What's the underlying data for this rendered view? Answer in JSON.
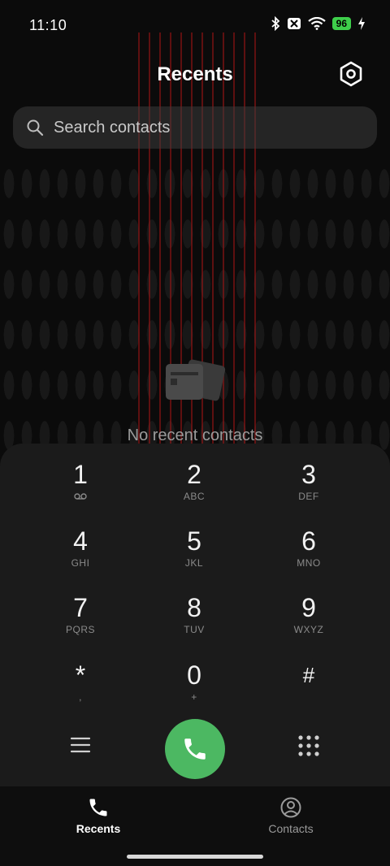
{
  "status_bar": {
    "time": "11:10",
    "battery_level": "96",
    "icons": [
      "bluetooth-icon",
      "sim-off-icon",
      "wifi-icon",
      "battery-icon",
      "charging-icon"
    ]
  },
  "header": {
    "title": "Recents",
    "settings_icon": "settings-hexagon-icon"
  },
  "search": {
    "placeholder": "Search contacts",
    "icon": "search-icon"
  },
  "empty_state": {
    "icon": "recent-contacts-empty-icon",
    "text": "No recent contacts"
  },
  "dialpad": {
    "keys": [
      {
        "digit": "1",
        "letters": "",
        "voicemail": true
      },
      {
        "digit": "2",
        "letters": "ABC"
      },
      {
        "digit": "3",
        "letters": "DEF"
      },
      {
        "digit": "4",
        "letters": "GHI"
      },
      {
        "digit": "5",
        "letters": "JKL"
      },
      {
        "digit": "6",
        "letters": "MNO"
      },
      {
        "digit": "7",
        "letters": "PQRS"
      },
      {
        "digit": "8",
        "letters": "TUV"
      },
      {
        "digit": "9",
        "letters": "WXYZ"
      },
      {
        "digit": "*",
        "letters": ","
      },
      {
        "digit": "0",
        "letters": "+"
      },
      {
        "digit": "#",
        "letters": ""
      }
    ],
    "call_button_color": "#4cb862"
  },
  "bottom_nav": {
    "items": [
      {
        "label": "Recents",
        "icon": "phone-icon",
        "active": true
      },
      {
        "label": "Contacts",
        "icon": "contact-avatar-icon",
        "active": false
      }
    ]
  },
  "colors": {
    "background": "#0b0b0b",
    "dialpad_bg": "#1b1b1b",
    "accent_green": "#4cb862",
    "battery_green": "#3ecf4b"
  }
}
